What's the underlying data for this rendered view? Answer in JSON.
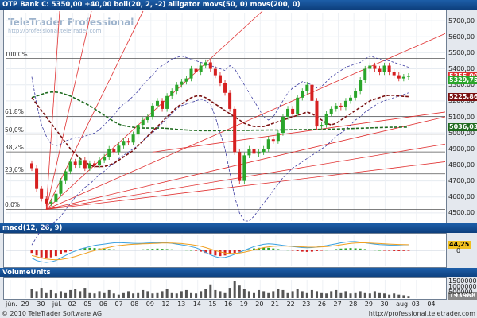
{
  "header": {
    "main": "OTP Bank C: 5350,00 +40,00 boll(20, 2, -2) alligator movs(50, 0) movs(200, 0)",
    "macd": "macd(12, 26, 9)",
    "volume": "VolumeUnits"
  },
  "watermark": {
    "brand": "TeleTrader Professional",
    "url": "http://professional.teletrader.com"
  },
  "footer": {
    "left": "© 2010 TeleTrader Software AG",
    "right": "http://professional.teletrader.com"
  },
  "colors": {
    "up": "#2aa52a",
    "down": "#d62020",
    "accent_red": "#e03030",
    "ma_dark_red": "#7a1010",
    "ma_dark_green": "#1f6b1f",
    "boll": "#3a3aa0",
    "macd_signal": "#f0a020",
    "macd_line": "#3aa0e0"
  },
  "fib_levels": [
    {
      "label": "100,0%",
      "value": 5464
    },
    {
      "label": "61,8%",
      "value": 5103
    },
    {
      "label": "50,0%",
      "value": 4992
    },
    {
      "label": "38,2%",
      "value": 4881
    },
    {
      "label": "23,6%",
      "value": 4744
    },
    {
      "label": "0,0%",
      "value": 4522
    }
  ],
  "value_badges": {
    "main": [
      {
        "text": "5355,00",
        "value": 5355,
        "bg": "#e03030",
        "fg": "#ffffff"
      },
      {
        "text": "5329,75",
        "value": 5329,
        "bg": "#2aa52a",
        "fg": "#ffffff"
      },
      {
        "text": "5225,86",
        "value": 5225,
        "bg": "#7a1010",
        "fg": "#ffffff"
      },
      {
        "text": "5036,03",
        "value": 5036,
        "bg": "#1f6b1f",
        "fg": "#ffffff"
      }
    ],
    "macd": [
      {
        "text": "44,25",
        "value": 44.25,
        "bg": "#f0c020",
        "fg": "#000000"
      }
    ],
    "volume": [
      {
        "text": "193988",
        "value": 193988,
        "bg": "#888888",
        "fg": "#ffffff"
      }
    ]
  },
  "chart_data": [
    {
      "type": "candlestick",
      "title": "OTP Bank C: 5350,00 +40,00 boll(20, 2, -2) alligator movs(50, 0) movs(200, 0)",
      "ylim": [
        4450,
        5750
      ],
      "y_ticks": [
        4500,
        4600,
        4700,
        4800,
        4900,
        5000,
        5100,
        5200,
        5300,
        5400,
        5500,
        5600,
        5700
      ],
      "y_tick_labels": [
        "4500,00",
        "4600,00",
        "4700,00",
        "4800,00",
        "4900,00",
        "5000,00",
        "5100,00",
        "5200,00",
        "5300,00",
        "5400,00",
        "5500,00",
        "5600,00",
        "5700,00"
      ],
      "x_labels": [
        "jún.",
        "29",
        "30",
        "júl.",
        "02",
        "05",
        "06",
        "07",
        "08",
        "09",
        "12",
        "13",
        "14",
        "15",
        "16",
        "19",
        "20",
        "21",
        "22",
        "23",
        "26",
        "27",
        "28",
        "29",
        "30",
        "aug.",
        "03",
        "04"
      ],
      "grid": true,
      "series": {
        "close": [
          4780,
          4650,
          4590,
          4560,
          4570,
          4620,
          4700,
          4760,
          4820,
          4800,
          4830,
          4780,
          4810,
          4800,
          4830,
          4850,
          4900,
          4880,
          4920,
          4950,
          4940,
          4990,
          5050,
          5080,
          5100,
          5170,
          5200,
          5150,
          5230,
          5260,
          5300,
          5320,
          5340,
          5400,
          5380,
          5420,
          5440,
          5400,
          5360,
          5310,
          5250,
          5150,
          4880,
          4700,
          4860,
          4900,
          4870,
          4880,
          4900,
          4960,
          4950,
          5000,
          5100,
          5150,
          5120,
          5220,
          5260,
          5300,
          5200,
          5040,
          5050,
          5120,
          5150,
          5170,
          5160,
          5200,
          5220,
          5260,
          5330,
          5400,
          5420,
          5400,
          5380,
          5420,
          5380,
          5360,
          5340,
          5350,
          5355
        ],
        "bollinger_upper": [
          5350,
          5180,
          5050,
          4980,
          4930,
          4920,
          4930,
          4950,
          4960,
          4970,
          4970,
          4980,
          4990,
          5000,
          5020,
          5050,
          5080,
          5110,
          5150,
          5180,
          5200,
          5230,
          5260,
          5300,
          5330,
          5360,
          5400,
          5420,
          5440,
          5460,
          5470,
          5480,
          5470,
          5460,
          5450,
          5440,
          5430,
          5420,
          5410,
          5400,
          5390,
          5420,
          5400,
          5350,
          5300,
          5250,
          5200,
          5150,
          5100,
          5080,
          5100,
          5150,
          5200,
          5250,
          5280,
          5300,
          5320,
          5310,
          5300,
          5280,
          5290,
          5320,
          5350,
          5370,
          5390,
          5410,
          5420,
          5430,
          5440,
          5460,
          5480,
          5470,
          5460,
          5450,
          5450,
          5440,
          5430,
          5420,
          5410
        ],
        "bollinger_lower": [
          4300,
          4350,
          4400,
          4420,
          4430,
          4450,
          4480,
          4520,
          4560,
          4600,
          4630,
          4660,
          4680,
          4710,
          4740,
          4760,
          4790,
          4810,
          4840,
          4860,
          4880,
          4900,
          4920,
          4950,
          4980,
          5000,
          5030,
          5060,
          5090,
          5120,
          5150,
          5170,
          5180,
          5190,
          5200,
          5210,
          5200,
          5180,
          5100,
          5000,
          4900,
          4750,
          4600,
          4500,
          4450,
          4450,
          4480,
          4520,
          4560,
          4600,
          4640,
          4680,
          4720,
          4750,
          4780,
          4800,
          4820,
          4840,
          4860,
          4880,
          4900,
          4920,
          4950,
          4980,
          5000,
          5020,
          5050,
          5080,
          5100,
          5130,
          5150,
          5170,
          5190,
          5200,
          5210,
          5220,
          5230,
          5240,
          5250
        ],
        "ma50": [
          5220,
          5180,
          5140,
          5100,
          5060,
          5020,
          4980,
          4940,
          4900,
          4870,
          4840,
          4820,
          4800,
          4790,
          4790,
          4790,
          4800,
          4810,
          4830,
          4850,
          4870,
          4890,
          4920,
          4950,
          4980,
          5010,
          5040,
          5070,
          5100,
          5130,
          5160,
          5180,
          5200,
          5220,
          5230,
          5230,
          5220,
          5200,
          5180,
          5160,
          5140,
          5120,
          5100,
          5080,
          5060,
          5050,
          5040,
          5040,
          5040,
          5050,
          5060,
          5070,
          5080,
          5090,
          5100,
          5110,
          5120,
          5130,
          5120,
          5100,
          5080,
          5060,
          5050,
          5060,
          5080,
          5100,
          5120,
          5140,
          5160,
          5180,
          5200,
          5210,
          5220,
          5230,
          5235,
          5235,
          5230,
          5228,
          5226
        ],
        "ma200": [
          5220,
          5230,
          5240,
          5250,
          5255,
          5255,
          5250,
          5240,
          5230,
          5215,
          5200,
          5185,
          5170,
          5150,
          5130,
          5110,
          5090,
          5070,
          5055,
          5045,
          5040,
          5035,
          5030,
          5030,
          5030,
          5030,
          5030,
          5030,
          5028,
          5025,
          5022,
          5020,
          5018,
          5016,
          5015,
          5014,
          5014,
          5014,
          5014,
          5015,
          5015,
          5015,
          5015,
          5016,
          5016,
          5016,
          5017,
          5017,
          5017,
          5018,
          5018,
          5018,
          5019,
          5019,
          5020,
          5020,
          5020,
          5021,
          5021,
          5022,
          5022,
          5023,
          5023,
          5024,
          5025,
          5026,
          5027,
          5028,
          5029,
          5030,
          5031,
          5032,
          5033,
          5034,
          5035,
          5035,
          5036,
          5036,
          5036
        ]
      }
    },
    {
      "type": "bar",
      "title": "macd(12, 26, 9)",
      "ylim": [
        -120,
        120
      ],
      "y_ticks": [
        0
      ],
      "y_tick_labels": [
        "0"
      ],
      "histogram": [
        -20,
        -40,
        -55,
        -60,
        -55,
        -45,
        -30,
        -15,
        -5,
        5,
        12,
        18,
        20,
        18,
        15,
        12,
        10,
        8,
        6,
        5,
        4,
        5,
        6,
        8,
        10,
        12,
        14,
        12,
        10,
        8,
        6,
        4,
        2,
        0,
        -4,
        -10,
        -20,
        -30,
        -40,
        -45,
        -40,
        -30,
        -20,
        -10,
        0,
        8,
        15,
        20,
        22,
        20,
        15,
        10,
        6,
        2,
        -2,
        -6,
        -10,
        -12,
        -10,
        -6,
        -2,
        2,
        6,
        10,
        14,
        16,
        18,
        16,
        14,
        10,
        6,
        2,
        0,
        -2,
        -4,
        -6,
        -6,
        -5,
        -4
      ],
      "macd_line": [
        -60,
        -80,
        -90,
        -95,
        -90,
        -80,
        -60,
        -40,
        -20,
        -5,
        10,
        20,
        30,
        40,
        45,
        50,
        55,
        60,
        62,
        60,
        58,
        56,
        55,
        56,
        58,
        60,
        62,
        62,
        60,
        56,
        50,
        44,
        38,
        30,
        20,
        5,
        -15,
        -35,
        -50,
        -58,
        -55,
        -45,
        -30,
        -15,
        0,
        15,
        30,
        40,
        48,
        52,
        50,
        45,
        40,
        35,
        30,
        26,
        22,
        20,
        22,
        26,
        32,
        38,
        45,
        52,
        60,
        66,
        70,
        70,
        66,
        60,
        54,
        50,
        46,
        44,
        42,
        42,
        43,
        44,
        44
      ],
      "signal_line": [
        -40,
        -50,
        -60,
        -68,
        -72,
        -74,
        -72,
        -66,
        -58,
        -48,
        -36,
        -24,
        -12,
        -2,
        8,
        16,
        24,
        32,
        38,
        42,
        46,
        48,
        50,
        52,
        53,
        55,
        56,
        58,
        58,
        58,
        56,
        54,
        50,
        46,
        40,
        32,
        22,
        10,
        -2,
        -12,
        -20,
        -24,
        -24,
        -20,
        -14,
        -6,
        4,
        14,
        22,
        28,
        32,
        34,
        34,
        33,
        32,
        30,
        28,
        26,
        25,
        26,
        28,
        30,
        34,
        38,
        44,
        50,
        55,
        58,
        60,
        60,
        58,
        56,
        54,
        52,
        50,
        48,
        47,
        46,
        45
      ]
    },
    {
      "type": "bar",
      "title": "VolumeUnits",
      "ylim": [
        0,
        1600000
      ],
      "y_ticks": [
        500000,
        1000000,
        1500000
      ],
      "y_tick_labels": [
        "500000",
        "1000000",
        "1500000"
      ],
      "values": [
        800000,
        600000,
        900000,
        500000,
        700000,
        400000,
        600000,
        500000,
        700000,
        800000,
        600000,
        900000,
        500000,
        400000,
        600000,
        500000,
        700000,
        400000,
        300000,
        500000,
        600000,
        400000,
        500000,
        700000,
        600000,
        400000,
        500000,
        600000,
        800000,
        500000,
        400000,
        600000,
        700000,
        500000,
        400000,
        600000,
        800000,
        1200000,
        700000,
        600000,
        500000,
        900000,
        1500000,
        1100000,
        800000,
        600000,
        500000,
        700000,
        600000,
        500000,
        600000,
        800000,
        700000,
        500000,
        600000,
        800000,
        600000,
        500000,
        700000,
        600000,
        500000,
        400000,
        600000,
        700000,
        500000,
        600000,
        400000,
        500000,
        600000,
        500000,
        400000,
        600000,
        500000,
        400000,
        300000,
        400000,
        300000,
        250000,
        193988
      ]
    }
  ]
}
